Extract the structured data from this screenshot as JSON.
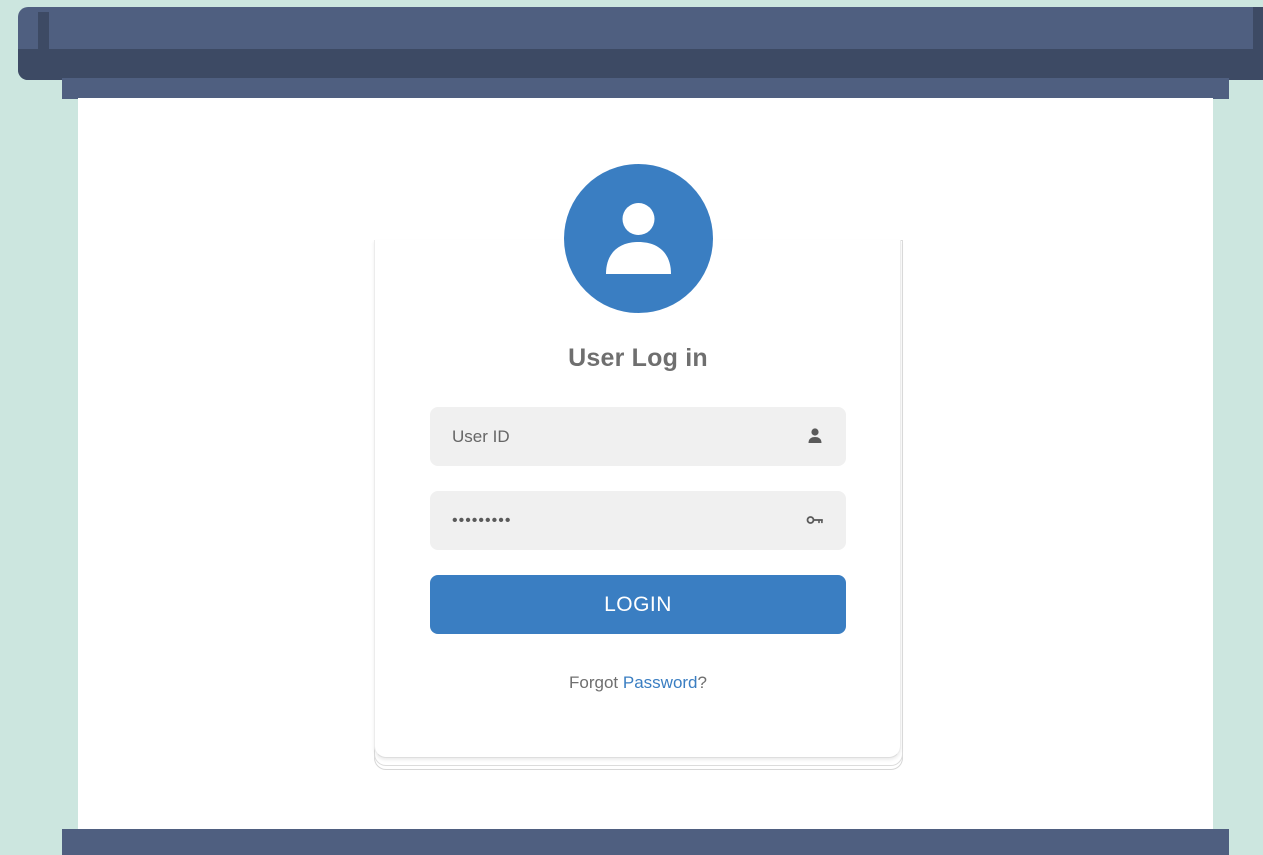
{
  "login": {
    "title": "User Log in",
    "user_field": {
      "placeholder": "User ID",
      "value": "",
      "icon": "user-icon"
    },
    "password_field": {
      "value": "•••••••••",
      "icon": "key-icon"
    },
    "login_button_label": "LOGIN",
    "forgot": {
      "prefix": "Forgot ",
      "link_text": "Password",
      "suffix": "?"
    }
  },
  "icons": {
    "avatar": "user-avatar-icon"
  },
  "colors": {
    "accent": "#3a7ec2",
    "frame": "#4f5f80",
    "frame_dark": "#3d4a64",
    "background": "#cce6df",
    "field_bg": "#f0f0f0",
    "text_muted": "#6f6f6f"
  }
}
